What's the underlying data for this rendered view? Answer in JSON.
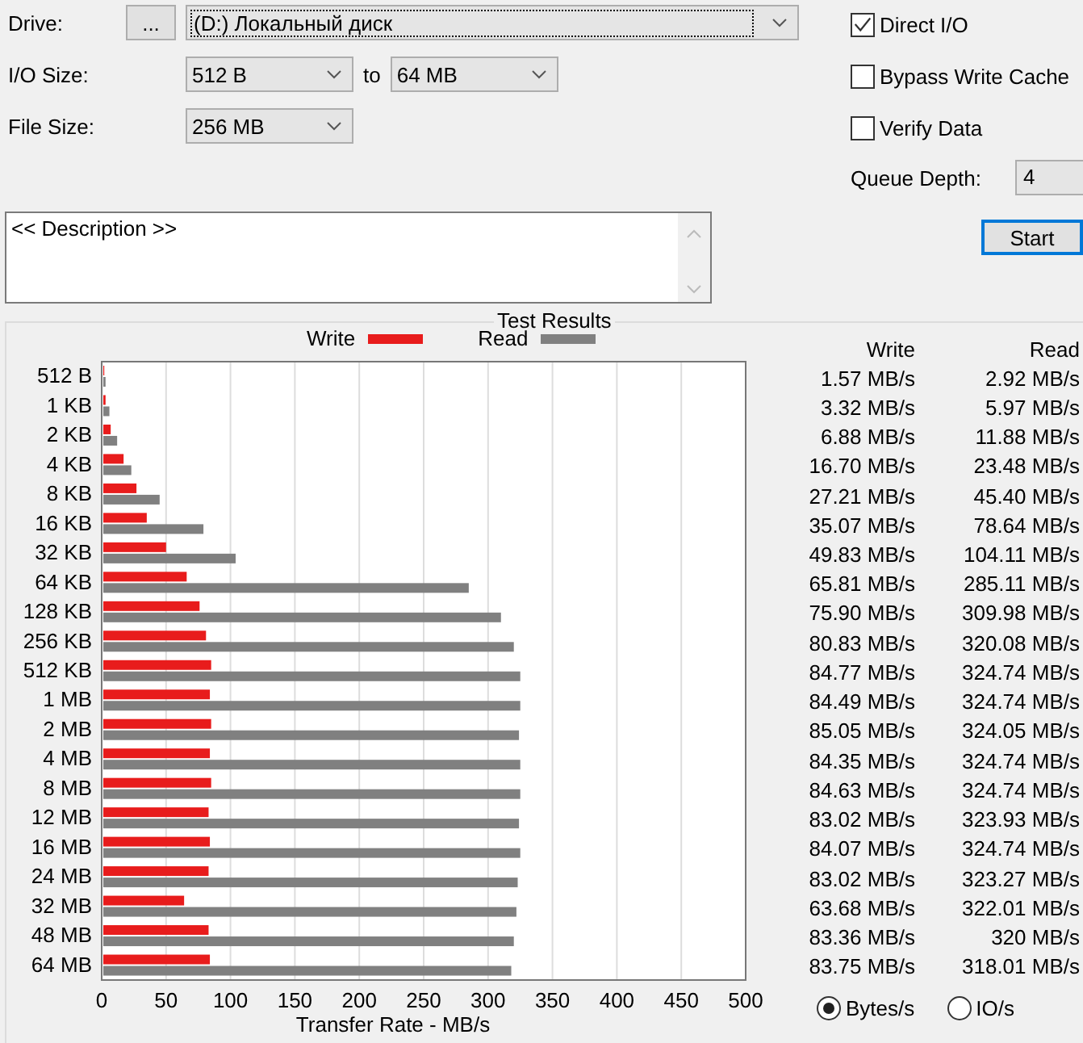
{
  "drive": {
    "label": "Drive:",
    "browse_button": "...",
    "value": "(D:) Локальный диск"
  },
  "io_size": {
    "label": "I/O Size:",
    "from": "512 B",
    "to_label": "to",
    "to": "64 MB"
  },
  "file_size": {
    "label": "File Size:",
    "value": "256 MB"
  },
  "options": [
    {
      "label": "Direct I/O",
      "checked": true
    },
    {
      "label": "Bypass Write Cache",
      "checked": false
    },
    {
      "label": "Verify Data",
      "checked": false
    }
  ],
  "queue_depth": {
    "label": "Queue Depth:",
    "value": "4"
  },
  "description": {
    "value": "<< Description >>"
  },
  "start_button": "Start",
  "results": {
    "title": "Test Results",
    "chart_data": {
      "type": "bar",
      "orientation": "horizontal",
      "grid": true,
      "xlabel": "Transfer Rate - MB/s",
      "xlim": [
        0,
        500
      ],
      "xticks": [
        0,
        50,
        100,
        150,
        200,
        250,
        300,
        350,
        400,
        450,
        500
      ],
      "categories": [
        "512 B",
        "1 KB",
        "2 KB",
        "4 KB",
        "8 KB",
        "16 KB",
        "32 KB",
        "64 KB",
        "128 KB",
        "256 KB",
        "512 KB",
        "1 MB",
        "2 MB",
        "4 MB",
        "8 MB",
        "12 MB",
        "16 MB",
        "24 MB",
        "32 MB",
        "48 MB",
        "64 MB"
      ],
      "series": [
        {
          "name": "Write",
          "color": "#e81c1c",
          "values": [
            2,
            3,
            7,
            17,
            27,
            35,
            50,
            66,
            76,
            81,
            85,
            84,
            85,
            84,
            85,
            83,
            84,
            83,
            64,
            83,
            84
          ]
        },
        {
          "name": "Read",
          "color": "#808080",
          "values": [
            3,
            6,
            12,
            23,
            45,
            79,
            104,
            285,
            310,
            320,
            325,
            325,
            324,
            325,
            325,
            324,
            325,
            323,
            322,
            320,
            318
          ]
        }
      ]
    },
    "columns": [
      "Write",
      "Read"
    ],
    "rows": [
      [
        "1.57 MB/s",
        "2.92 MB/s"
      ],
      [
        "3.32 MB/s",
        "5.97 MB/s"
      ],
      [
        "6.88 MB/s",
        "11.88 MB/s"
      ],
      [
        "16.70 MB/s",
        "23.48 MB/s"
      ],
      [
        "27.21 MB/s",
        "45.40 MB/s"
      ],
      [
        "35.07 MB/s",
        "78.64 MB/s"
      ],
      [
        "49.83 MB/s",
        "104.11 MB/s"
      ],
      [
        "65.81 MB/s",
        "285.11 MB/s"
      ],
      [
        "75.90 MB/s",
        "309.98 MB/s"
      ],
      [
        "80.83 MB/s",
        "320.08 MB/s"
      ],
      [
        "84.77 MB/s",
        "324.74 MB/s"
      ],
      [
        "84.49 MB/s",
        "324.74 MB/s"
      ],
      [
        "85.05 MB/s",
        "324.05 MB/s"
      ],
      [
        "84.35 MB/s",
        "324.74 MB/s"
      ],
      [
        "84.63 MB/s",
        "324.74 MB/s"
      ],
      [
        "83.02 MB/s",
        "323.93 MB/s"
      ],
      [
        "84.07 MB/s",
        "324.74 MB/s"
      ],
      [
        "83.02 MB/s",
        "323.27 MB/s"
      ],
      [
        "63.68 MB/s",
        "322.01 MB/s"
      ],
      [
        "83.36 MB/s",
        "320 MB/s"
      ],
      [
        "83.75 MB/s",
        "318.01 MB/s"
      ]
    ],
    "units": [
      {
        "label": "Bytes/s",
        "selected": true
      },
      {
        "label": "IO/s",
        "selected": false
      }
    ]
  }
}
